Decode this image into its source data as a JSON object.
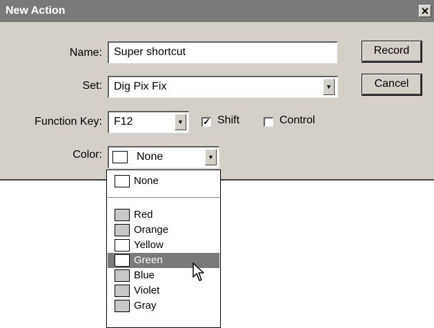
{
  "window": {
    "title": "New Action",
    "close_glyph": "✕"
  },
  "form": {
    "name_label": "Name:",
    "name_value": "Super shortcut",
    "set_label": "Set:",
    "set_value": "Dig Pix Fix",
    "fkey_label": "Function Key:",
    "fkey_value": "F12",
    "shift_label": "Shift",
    "shift_checked": true,
    "control_label": "Control",
    "control_checked": false,
    "color_label": "Color:",
    "color_value": "None"
  },
  "buttons": {
    "record": "Record",
    "cancel": "Cancel"
  },
  "color_menu": {
    "items": [
      {
        "label": "None",
        "swatch": "#ffffff"
      },
      {
        "label": "Red",
        "swatch": "#c8c8c8"
      },
      {
        "label": "Orange",
        "swatch": "#c8c8c8"
      },
      {
        "label": "Yellow",
        "swatch": "#ffffff"
      },
      {
        "label": "Green",
        "swatch": "#ffffff",
        "selected": true
      },
      {
        "label": "Blue",
        "swatch": "#c8c8c8"
      },
      {
        "label": "Violet",
        "swatch": "#c8c8c8"
      },
      {
        "label": "Gray",
        "swatch": "#c8c8c8"
      }
    ]
  },
  "glyphs": {
    "dropdown_arrow": "▼",
    "check": "✓"
  },
  "colors": {
    "titlebar": "#7a7a7a",
    "dialog_bg": "#d4d0c8",
    "selection": "#7a7a7a"
  }
}
